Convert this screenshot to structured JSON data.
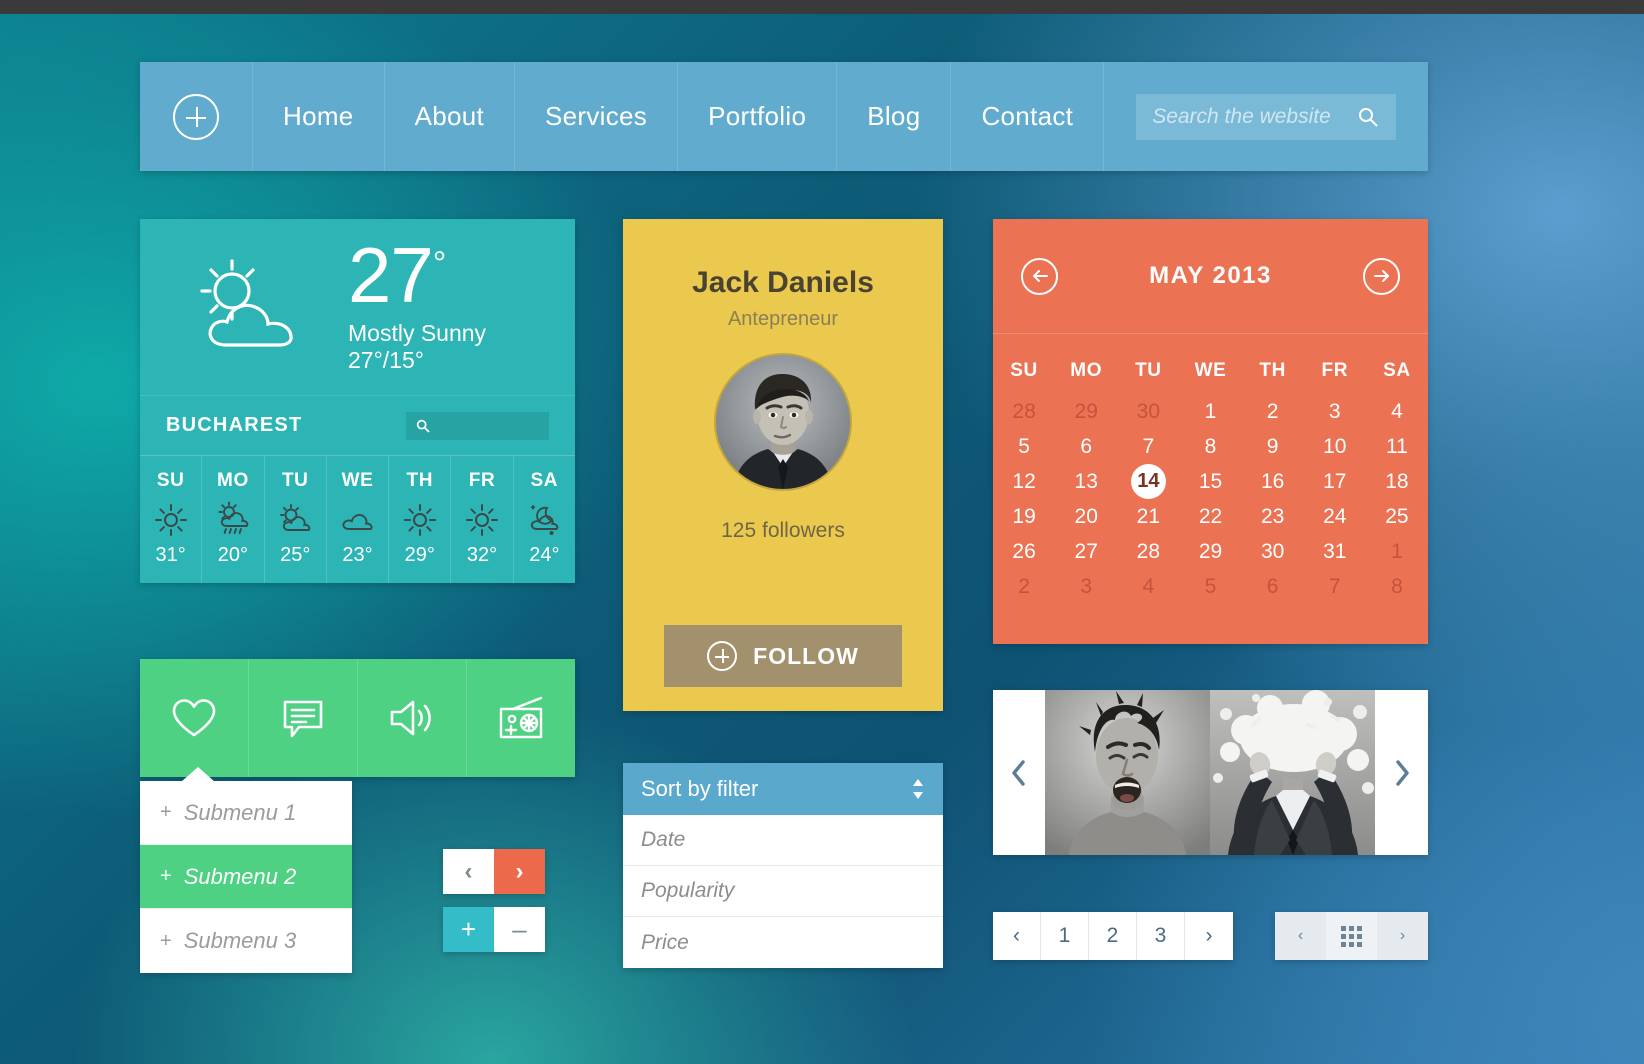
{
  "nav": {
    "add_label": "+",
    "items": [
      {
        "label": "Home"
      },
      {
        "label": "About"
      },
      {
        "label": "Services"
      },
      {
        "label": "Portfolio"
      },
      {
        "label": "Blog"
      },
      {
        "label": "Contact"
      }
    ],
    "search": {
      "placeholder": "Search the website",
      "value": ""
    }
  },
  "weather": {
    "temperature": "27",
    "degree": "°",
    "condition": "Mostly Sunny",
    "high_low": "27°/15°",
    "city": "BUCHAREST",
    "search_value": "",
    "icon": "sun-behind-cloud-icon",
    "forecast": [
      {
        "day": "SU",
        "icon": "sun-icon",
        "temp": "31°"
      },
      {
        "day": "MO",
        "icon": "sun-cloud-rain-icon",
        "temp": "20°"
      },
      {
        "day": "TU",
        "icon": "sun-cloud-icon",
        "temp": "25°"
      },
      {
        "day": "WE",
        "icon": "cloud-icon",
        "temp": "23°"
      },
      {
        "day": "TH",
        "icon": "sun-icon",
        "temp": "29°"
      },
      {
        "day": "FR",
        "icon": "sun-icon",
        "temp": "32°"
      },
      {
        "day": "SA",
        "icon": "moon-cloud-rain-icon",
        "temp": "24°"
      }
    ]
  },
  "iconbar": {
    "items": [
      {
        "icon": "heart-icon"
      },
      {
        "icon": "chat-bubble-icon"
      },
      {
        "icon": "speaker-icon"
      },
      {
        "icon": "radio-icon"
      }
    ]
  },
  "submenu": {
    "items": [
      {
        "prefix": "+",
        "label": "Submenu 1",
        "active": false
      },
      {
        "prefix": "+",
        "label": "Submenu 2",
        "active": true
      },
      {
        "prefix": "+",
        "label": "Submenu 3",
        "active": false
      }
    ]
  },
  "prevnext": {
    "prev": "‹",
    "next": "›"
  },
  "plusminus": {
    "plus": "+",
    "minus": "–"
  },
  "profile": {
    "name": "Jack Daniels",
    "role": "Antepreneur",
    "followers": "125 followers",
    "follow_label": "FOLLOW",
    "avatar": "portrait-avatar"
  },
  "sort_filter": {
    "header": "Sort by filter",
    "options": [
      {
        "label": "Date"
      },
      {
        "label": "Popularity"
      },
      {
        "label": "Price"
      }
    ]
  },
  "calendar": {
    "title": "MAY 2013",
    "prev_icon": "arrow-left-circle-icon",
    "next_icon": "arrow-right-circle-icon",
    "dow": [
      "SU",
      "MO",
      "TU",
      "WE",
      "TH",
      "FR",
      "SA"
    ],
    "weeks": [
      [
        {
          "d": "28",
          "m": true
        },
        {
          "d": "29",
          "m": true
        },
        {
          "d": "30",
          "m": true
        },
        {
          "d": "1"
        },
        {
          "d": "2"
        },
        {
          "d": "3"
        },
        {
          "d": "4"
        }
      ],
      [
        {
          "d": "5"
        },
        {
          "d": "6"
        },
        {
          "d": "7"
        },
        {
          "d": "8"
        },
        {
          "d": "9"
        },
        {
          "d": "10"
        },
        {
          "d": "11"
        }
      ],
      [
        {
          "d": "12"
        },
        {
          "d": "13"
        },
        {
          "d": "14",
          "today": true
        },
        {
          "d": "15"
        },
        {
          "d": "16"
        },
        {
          "d": "17"
        },
        {
          "d": "18"
        }
      ],
      [
        {
          "d": "19"
        },
        {
          "d": "20"
        },
        {
          "d": "21"
        },
        {
          "d": "22"
        },
        {
          "d": "23"
        },
        {
          "d": "24"
        },
        {
          "d": "25"
        }
      ],
      [
        {
          "d": "26"
        },
        {
          "d": "27"
        },
        {
          "d": "28"
        },
        {
          "d": "29"
        },
        {
          "d": "30"
        },
        {
          "d": "31"
        },
        {
          "d": "1",
          "m": true
        }
      ],
      [
        {
          "d": "2",
          "m": true
        },
        {
          "d": "3",
          "m": true
        },
        {
          "d": "4",
          "m": true
        },
        {
          "d": "5",
          "m": true
        },
        {
          "d": "6",
          "m": true
        },
        {
          "d": "7",
          "m": true
        },
        {
          "d": "8",
          "m": true
        }
      ]
    ]
  },
  "gallery": {
    "prev": "‹",
    "next": "›",
    "images": [
      {
        "alt": "screaming-man-photo"
      },
      {
        "alt": "exploding-head-man-photo"
      }
    ]
  },
  "pager": {
    "prev": "‹",
    "pages": [
      "1",
      "2",
      "3"
    ],
    "next": "›"
  },
  "grid_toggle": {
    "prev": "‹",
    "grid_icon": "grid-view-icon",
    "next": "›"
  },
  "colors": {
    "nav": "#61acce",
    "weather": "#2db5b5",
    "green": "#4ed183",
    "yellow": "#ebc94e",
    "orange": "#ec7254",
    "follow": "#a2916c",
    "filter_header": "#5aa9cd"
  }
}
